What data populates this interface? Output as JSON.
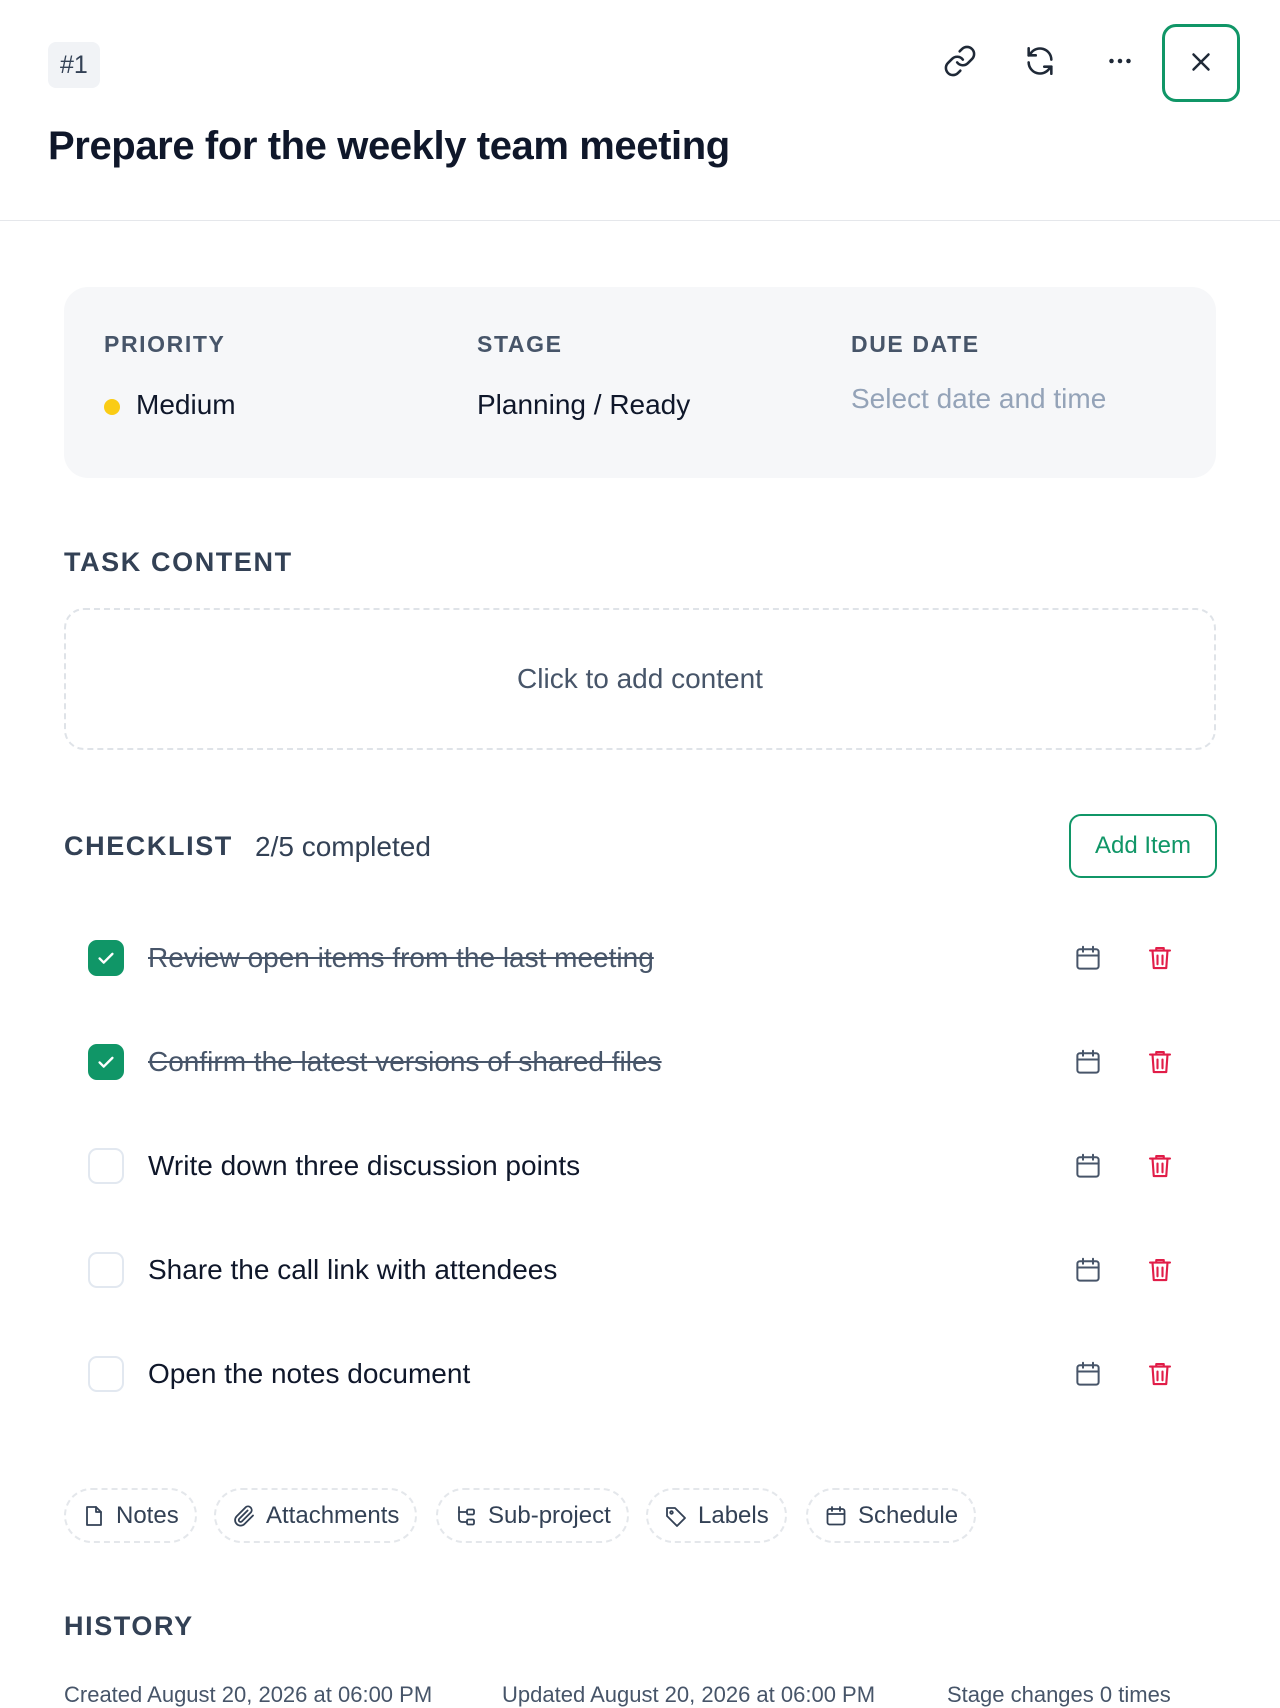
{
  "header": {
    "task_id": "#1",
    "title": "Prepare for the weekly team meeting"
  },
  "meta": {
    "priority_label": "PRIORITY",
    "priority_value": "Medium",
    "priority_color": "#facc15",
    "stage_label": "STAGE",
    "stage_value": "Planning / Ready",
    "due_label": "DUE DATE",
    "due_placeholder": "Select date and time"
  },
  "content": {
    "title": "TASK CONTENT",
    "placeholder": "Click to add content"
  },
  "checklist": {
    "title": "CHECKLIST",
    "progress": "2/5 completed",
    "add_label": "Add Item",
    "items": [
      {
        "text": "Review open items from the last meeting",
        "done": true
      },
      {
        "text": "Confirm the latest versions of shared files",
        "done": true
      },
      {
        "text": "Write down three discussion points",
        "done": false
      },
      {
        "text": "Share the call link with attendees",
        "done": false
      },
      {
        "text": "Open the notes document",
        "done": false
      }
    ]
  },
  "chips": [
    {
      "label": "Notes",
      "icon": "file-icon"
    },
    {
      "label": "Attachments",
      "icon": "paperclip-icon"
    },
    {
      "label": "Sub-project",
      "icon": "subproject-icon"
    },
    {
      "label": "Labels",
      "icon": "tag-icon"
    },
    {
      "label": "Schedule",
      "icon": "calendar-icon"
    }
  ],
  "history": {
    "title": "HISTORY",
    "created": "Created August 20, 2026 at 06:00 PM",
    "updated": "Updated August 20, 2026 at 06:00 PM",
    "stage_changes": "Stage changes 0 times"
  },
  "colors": {
    "accent": "#109667",
    "danger": "#e11d48"
  }
}
